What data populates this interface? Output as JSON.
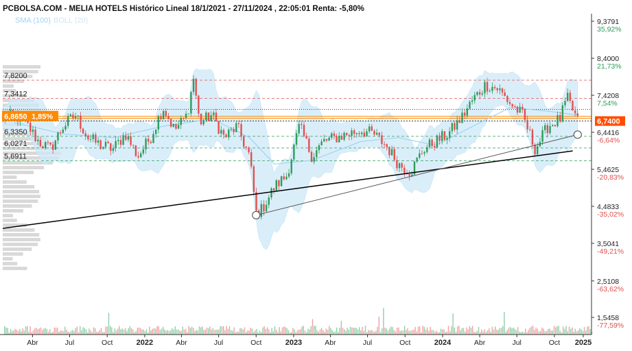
{
  "title": "PCBOLSA.COM - MELIA HOTELS Histórico Lineal 18/1/2021 - 27/11/2024 , 22:05:01 Renta: -5,80%",
  "indicators": [
    {
      "label": "SMA (100)",
      "color": "#9fd3f0"
    },
    {
      "label": "BOLL (20)",
      "color": "#cfe6f3"
    }
  ],
  "colors": {
    "up": "#2e9c5a",
    "down": "#e05050",
    "band": "#cde8f8",
    "sma": "#9fd3f0",
    "resistance": "#e05050",
    "support": "#2e9c5a",
    "badge_last": "#ff4d00",
    "badge_ref": "#ff8a00"
  },
  "right_axis": [
    {
      "value": "9,3791",
      "pct": "35,92%",
      "dir": "up"
    },
    {
      "value": "8,4000",
      "pct": "21,73%",
      "dir": "up"
    },
    {
      "value": "7,4208",
      "pct": "7,54%",
      "dir": "up"
    },
    {
      "value": "6,4416",
      "pct": "-6,64%",
      "dir": "down"
    },
    {
      "value": "5,4625",
      "pct": "-20,83%",
      "dir": "down"
    },
    {
      "value": "4,4833",
      "pct": "-35,02%",
      "dir": "down"
    },
    {
      "value": "3,5041",
      "pct": "-49,21%",
      "dir": "down"
    },
    {
      "value": "2,5108",
      "pct": "-63,62%",
      "dir": "down"
    },
    {
      "value": "1,5458",
      "pct": "-77,59%",
      "dir": "down"
    }
  ],
  "levels": [
    {
      "label": "7,8200",
      "value": 7.82,
      "kind": "resistance"
    },
    {
      "label": "7,3412",
      "value": 7.3412,
      "kind": "resistance"
    },
    {
      "label": "6,3350",
      "value": 6.335,
      "kind": "support"
    },
    {
      "label": "6,0271",
      "value": 6.0271,
      "kind": "support"
    },
    {
      "label": "5,6911",
      "value": 5.6911,
      "kind": "support"
    }
  ],
  "ref_badge": {
    "price": "6,8650",
    "pct": "1,85%",
    "value": 6.865
  },
  "last_badge": {
    "price": "6,7400",
    "value": 6.74
  },
  "x_axis": [
    {
      "label": "Abr",
      "bold": false
    },
    {
      "label": "Jul",
      "bold": false
    },
    {
      "label": "Oct",
      "bold": false
    },
    {
      "label": "2022",
      "bold": true
    },
    {
      "label": "Abr",
      "bold": false
    },
    {
      "label": "Jul",
      "bold": false
    },
    {
      "label": "Oct",
      "bold": false
    },
    {
      "label": "2023",
      "bold": true
    },
    {
      "label": "Abr",
      "bold": false
    },
    {
      "label": "Jul",
      "bold": false
    },
    {
      "label": "Oct",
      "bold": false
    },
    {
      "label": "2024",
      "bold": true
    },
    {
      "label": "Abr",
      "bold": false
    },
    {
      "label": "Jul",
      "bold": false
    },
    {
      "label": "Oct",
      "bold": false
    },
    {
      "label": "2025",
      "bold": true
    }
  ],
  "chart_data": {
    "type": "line",
    "title": "PCBOLSA.COM - MELIA HOTELS Histórico Lineal 18/1/2021 - 27/11/2024 , 22:05:01 Renta: -5,80%",
    "xlabel": "",
    "ylabel": "",
    "ylim": [
      1.5458,
      9.3791
    ],
    "x_range": [
      "2021-01-18",
      "2024-11-27"
    ],
    "grid": false,
    "series": [
      {
        "type": "candlestick-approx",
        "x": [
          "2021-01-18",
          "2021-02-15",
          "2021-03-15",
          "2021-04-15",
          "2021-05-15",
          "2021-06-15",
          "2021-07-15",
          "2021-08-15",
          "2021-09-15",
          "2021-10-15",
          "2021-11-15",
          "2021-12-15",
          "2022-01-15",
          "2022-02-15",
          "2022-03-15",
          "2022-04-15",
          "2022-05-01",
          "2022-05-15",
          "2022-06-15",
          "2022-07-15",
          "2022-08-15",
          "2022-09-15",
          "2022-10-01",
          "2022-10-15",
          "2022-11-15",
          "2022-12-15",
          "2023-01-15",
          "2023-02-15",
          "2023-03-15",
          "2023-04-15",
          "2023-05-15",
          "2023-06-15",
          "2023-07-15",
          "2023-08-15",
          "2023-09-15",
          "2023-10-15",
          "2023-11-15",
          "2023-12-15",
          "2024-01-15",
          "2024-02-15",
          "2024-03-15",
          "2024-04-15",
          "2024-05-15",
          "2024-06-15",
          "2024-07-15",
          "2024-08-15",
          "2024-09-15",
          "2024-10-15",
          "2024-11-01",
          "2024-11-27"
        ],
        "values": [
          6.8,
          6.9,
          6.7,
          6.2,
          6.0,
          6.6,
          6.9,
          6.3,
          6.1,
          6.0,
          6.4,
          5.8,
          6.3,
          7.1,
          6.5,
          6.9,
          7.9,
          6.7,
          6.9,
          6.3,
          6.6,
          5.8,
          4.3,
          4.4,
          5.0,
          5.3,
          6.6,
          5.8,
          6.2,
          6.3,
          6.4,
          6.5,
          6.4,
          6.1,
          5.6,
          5.4,
          6.0,
          6.2,
          6.4,
          6.8,
          7.3,
          7.7,
          7.6,
          7.2,
          6.9,
          6.0,
          6.6,
          6.8,
          7.35,
          6.74
        ]
      },
      {
        "name": "SMA (100)",
        "x": [
          "2021-02-15",
          "2021-06-15",
          "2021-10-15",
          "2022-02-15",
          "2022-06-15",
          "2022-09-15",
          "2022-11-15",
          "2023-02-15",
          "2023-06-15",
          "2023-09-15",
          "2023-12-15",
          "2024-03-15",
          "2024-06-15",
          "2024-09-15",
          "2024-11-27"
        ],
        "values": [
          6.7,
          6.4,
          6.3,
          6.6,
          6.8,
          6.3,
          5.6,
          5.7,
          6.2,
          6.3,
          6.1,
          6.6,
          7.1,
          7.0,
          6.9
        ]
      }
    ],
    "levels": [
      7.82,
      7.3412,
      6.335,
      6.0271,
      5.6911
    ],
    "last_value": 6.74,
    "reference_value": 6.865,
    "trendlines": [
      {
        "from": [
          "2021-01-18",
          3.9
        ],
        "to": [
          "2024-11-15",
          5.95
        ]
      },
      {
        "from": [
          "2022-10-01",
          4.25
        ],
        "to": [
          "2024-11-27",
          6.38
        ]
      }
    ],
    "volume": "present"
  }
}
